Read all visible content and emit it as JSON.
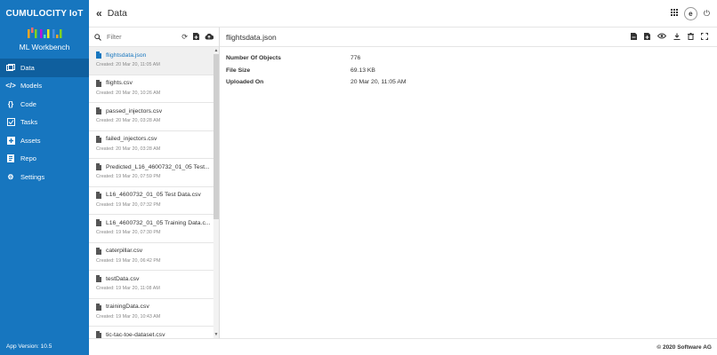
{
  "sidebar": {
    "brand": "CUMULOCITY IoT",
    "app_name": "ML Workbench",
    "items": [
      {
        "label": "Data",
        "icon": "data-icon"
      },
      {
        "label": "Models",
        "icon": "code-brackets-icon"
      },
      {
        "label": "Code",
        "icon": "curly-braces-icon"
      },
      {
        "label": "Tasks",
        "icon": "tasks-icon"
      },
      {
        "label": "Assets",
        "icon": "assets-icon"
      },
      {
        "label": "Repo",
        "icon": "repo-icon"
      },
      {
        "label": "Settings",
        "icon": "gear-icon"
      }
    ],
    "version": "App Version: 10.5"
  },
  "header": {
    "title": "Data",
    "avatar_initial": "e"
  },
  "search": {
    "placeholder": "Filter"
  },
  "files": [
    {
      "name": "flightsdata.json",
      "created": "Created: 20 Mar 20, 11:05 AM"
    },
    {
      "name": "flights.csv",
      "created": "Created: 20 Mar 20, 10:26 AM"
    },
    {
      "name": "passed_injectors.csv",
      "created": "Created: 20 Mar 20, 03:28 AM"
    },
    {
      "name": "failed_injectors.csv",
      "created": "Created: 20 Mar 20, 03:28 AM"
    },
    {
      "name": "Predicted_L16_4600732_01_05 Test...",
      "created": "Created: 19 Mar 20, 07:59 PM"
    },
    {
      "name": "L16_4600732_01_05 Test Data.csv",
      "created": "Created: 19 Mar 20, 07:32 PM"
    },
    {
      "name": "L16_4600732_01_05 Training Data.c...",
      "created": "Created: 19 Mar 20, 07:30 PM"
    },
    {
      "name": "caterpillar.csv",
      "created": "Created: 19 Mar 20, 06:42 PM"
    },
    {
      "name": "testData.csv",
      "created": "Created: 19 Mar 20, 11:08 AM"
    },
    {
      "name": "trainingData.csv",
      "created": "Created: 19 Mar 20, 10:43 AM"
    },
    {
      "name": "tic-tac-toe-dataset.csv",
      "created": ""
    }
  ],
  "details": {
    "title": "flightsdata.json",
    "properties": [
      {
        "label": "Number Of Objects",
        "value": "776"
      },
      {
        "label": "File Size",
        "value": "69.13 KB"
      },
      {
        "label": "Uploaded On",
        "value": "20 Mar 20, 11:05 AM"
      }
    ]
  },
  "footer": {
    "copyright": "© 2020 Software AG"
  },
  "colors": {
    "sidebar": "#1776bf",
    "sidebar_active": "#0f5f9e",
    "accent": "#1776bf"
  }
}
